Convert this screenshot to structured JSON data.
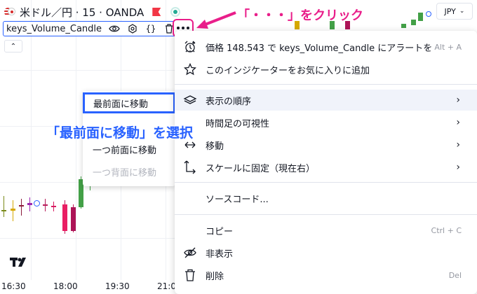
{
  "header": {
    "symbol_title": "米ドル／円 · 15 · OANDA",
    "currency": "JPY"
  },
  "indicator": {
    "name": "keys_Volume_Candle"
  },
  "callouts": {
    "click_more": "「・・・」をクリック",
    "select_front": "「最前面に移動」を選択"
  },
  "submenu": {
    "items": [
      {
        "label": "最前面に移動",
        "state": "highlighted"
      },
      {
        "label": "一つ前面に移動",
        "state": "enabled"
      },
      {
        "label": "一つ背面に移動",
        "state": "disabled"
      }
    ]
  },
  "menu": {
    "items": [
      {
        "icon": "alarm-clock-icon",
        "label": "価格 148.543 で keys_Volume_Candle にアラートを",
        "shortcut": "Alt + A"
      },
      {
        "icon": "star-icon",
        "label": "このインジケーターをお気に入りに追加"
      },
      {
        "icon": "layers-icon",
        "label": "表示の順序",
        "submenu": true
      },
      {
        "icon": "eye-icon",
        "label": "時間足の可視性",
        "submenu": true
      },
      {
        "icon": "move-icon",
        "label": "移動",
        "submenu": true
      },
      {
        "icon": "scale-pin-icon",
        "label": "スケールに固定（現在右）",
        "submenu": true
      },
      {
        "icon": "",
        "label": "ソースコード..."
      },
      {
        "icon": "",
        "label": "コピー",
        "shortcut": "Ctrl + C"
      },
      {
        "icon": "eye-off-icon",
        "label": "非表示"
      },
      {
        "icon": "trash-icon",
        "label": "削除",
        "shortcut": "Del"
      }
    ]
  },
  "time_axis": [
    "16:30",
    "18:00",
    "19:30",
    "21:00"
  ],
  "colors": {
    "accent_blue": "#2962ff",
    "callout_pink": "#e91e8a",
    "candle_up": "#22ab94",
    "candle_down": "#f23645"
  }
}
